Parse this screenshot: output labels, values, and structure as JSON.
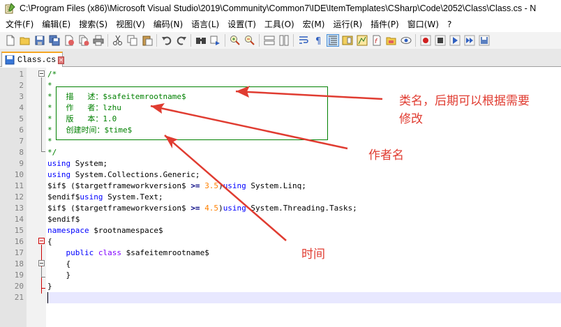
{
  "window": {
    "title": "C:\\Program Files (x86)\\Microsoft Visual Studio\\2019\\Community\\Common7\\IDE\\ItemTemplates\\CSharp\\Code\\2052\\Class\\Class.cs - N"
  },
  "menu": [
    "文件(F)",
    "编辑(E)",
    "搜索(S)",
    "视图(V)",
    "编码(N)",
    "语言(L)",
    "设置(T)",
    "工具(O)",
    "宏(M)",
    "运行(R)",
    "插件(P)",
    "窗口(W)",
    "?"
  ],
  "toolbar_icons": [
    "new-file-icon",
    "open-file-icon",
    "save-icon",
    "save-all-icon",
    "close-icon",
    "close-all-icon",
    "print-icon",
    "cut-icon",
    "copy-icon",
    "paste-icon",
    "undo-icon",
    "redo-icon",
    "find-icon",
    "replace-icon",
    "zoom-in-icon",
    "zoom-out-icon",
    "sync-vertical-icon",
    "sync-horizontal-icon",
    "word-wrap-icon",
    "show-all-chars-icon",
    "indent-guide-icon",
    "document-map-icon",
    "function-list-icon",
    "folder-workspace-icon",
    "monitor-icon",
    "record-macro-icon",
    "stop-record-icon",
    "play-macro-icon",
    "run-macro-multiple-icon",
    "save-macro-icon"
  ],
  "tab": {
    "label": "Class.cs",
    "close": "✕"
  },
  "editor": {
    "line_numbers": [
      "1",
      "2",
      "3",
      "4",
      "5",
      "6",
      "7",
      "8",
      "9",
      "10",
      "11",
      "12",
      "13",
      "14",
      "15",
      "16",
      "17",
      "18",
      "19",
      "20",
      "21"
    ],
    "lines": [
      [
        {
          "t": "/*",
          "c": "cm"
        }
      ],
      [
        {
          "t": "*",
          "c": "cm"
        }
      ],
      [
        {
          "t": "*   描   述：$safeitemrootname$",
          "c": "cm"
        }
      ],
      [
        {
          "t": "*   作   者：lzhu",
          "c": "cm"
        }
      ],
      [
        {
          "t": "*   版   本：1.0",
          "c": "cm"
        }
      ],
      [
        {
          "t": "*   创建时间：$time$",
          "c": "cm"
        }
      ],
      [
        {
          "t": "*",
          "c": "cm"
        }
      ],
      [
        {
          "t": "*/",
          "c": "cm"
        }
      ],
      [
        {
          "t": "using",
          "c": "kw"
        },
        {
          "t": " System;",
          "c": ""
        }
      ],
      [
        {
          "t": "using",
          "c": "kw"
        },
        {
          "t": " System.Collections.Generic;",
          "c": ""
        }
      ],
      [
        {
          "t": "$if$ ($targetframeworkversion$ ",
          "c": ""
        },
        {
          "t": ">=",
          "c": "op"
        },
        {
          "t": " ",
          "c": ""
        },
        {
          "t": "3.5",
          "c": "num"
        },
        {
          "t": ")",
          "c": ""
        },
        {
          "t": "using",
          "c": "kw"
        },
        {
          "t": " System.Linq;",
          "c": ""
        }
      ],
      [
        {
          "t": "$endif$",
          "c": ""
        },
        {
          "t": "using",
          "c": "kw"
        },
        {
          "t": " System.Text;",
          "c": ""
        }
      ],
      [
        {
          "t": "$if$ ($targetframeworkversion$ ",
          "c": ""
        },
        {
          "t": ">=",
          "c": "op"
        },
        {
          "t": " ",
          "c": ""
        },
        {
          "t": "4.5",
          "c": "num"
        },
        {
          "t": ")",
          "c": ""
        },
        {
          "t": "using",
          "c": "kw"
        },
        {
          "t": " System.Threading.Tasks;",
          "c": ""
        }
      ],
      [
        {
          "t": "$endif$",
          "c": ""
        }
      ],
      [
        {
          "t": "namespace",
          "c": "kw"
        },
        {
          "t": " $rootnamespace$",
          "c": ""
        }
      ],
      [
        {
          "t": "{",
          "c": ""
        }
      ],
      [
        {
          "t": "    ",
          "c": ""
        },
        {
          "t": "public",
          "c": "kw"
        },
        {
          "t": " ",
          "c": ""
        },
        {
          "t": "class",
          "c": "kw2"
        },
        {
          "t": " $safeitemrootname$",
          "c": ""
        }
      ],
      [
        {
          "t": "    {",
          "c": ""
        }
      ],
      [
        {
          "t": "    }",
          "c": ""
        }
      ],
      [
        {
          "t": "}",
          "c": ""
        }
      ],
      [
        {
          "t": "",
          "c": ""
        }
      ]
    ]
  },
  "annotations": {
    "class_name": "类名，后期可以根据需要",
    "class_name_2": "修改",
    "author": "作者名",
    "time": "时间",
    "color": "#e03c31"
  }
}
